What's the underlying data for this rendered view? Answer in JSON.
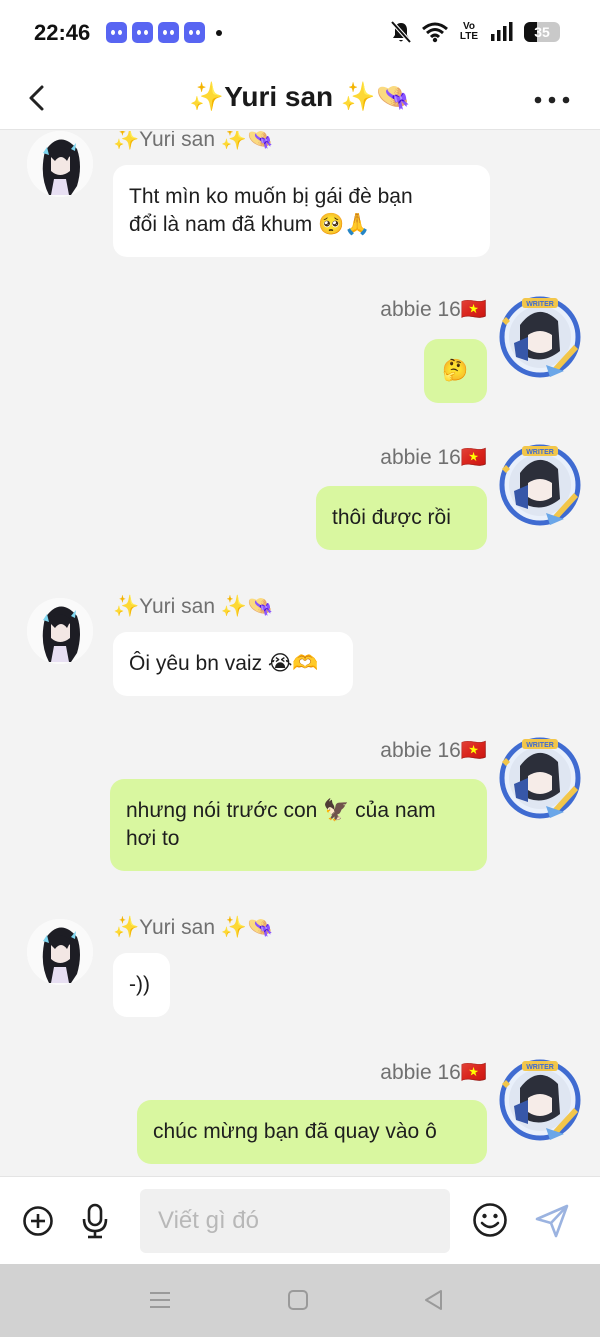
{
  "status_bar": {
    "time": "22:46",
    "notification_apps": [
      "discord-icon",
      "discord-icon",
      "discord-icon",
      "discord-icon"
    ],
    "volte": "Vo LTE",
    "battery": "35",
    "battery_level": 0.35
  },
  "header": {
    "title": "✨Yuri san ✨👒"
  },
  "messages": [
    {
      "direction": "in",
      "sender": "✨Yuri san ✨👒",
      "lines": [
        "Tht mìn ko muốn bị gái đè bạn",
        "đổi là nam đã khum 🥺🙏"
      ]
    },
    {
      "direction": "out",
      "sender": "abbie 16🇻🇳",
      "lines": [
        "🤔"
      ]
    },
    {
      "direction": "out",
      "sender": "abbie 16🇻🇳",
      "lines": [
        "thôi được rồi"
      ]
    },
    {
      "direction": "in",
      "sender": "✨Yuri san ✨👒",
      "lines": [
        "Ôi yêu bn vaiz 😭🫶"
      ]
    },
    {
      "direction": "out",
      "sender": "abbie 16🇻🇳",
      "lines": [
        "nhưng nói trước con 🦅 của nam",
        "hơi to"
      ]
    },
    {
      "direction": "in",
      "sender": "✨Yuri san ✨👒",
      "lines": [
        "-))"
      ]
    },
    {
      "direction": "out",
      "sender": "abbie 16🇻🇳",
      "lines": [
        "chúc mừng bạn đã quay vào ô"
      ]
    }
  ],
  "composer": {
    "placeholder": "Viết gì đó"
  },
  "avatar_badge": "WRITER",
  "colors": {
    "outgoing_bubble": "#d9f7a0",
    "incoming_bubble": "#ffffff",
    "background": "#f3f3f3",
    "send_icon": "#9bb3e0"
  }
}
